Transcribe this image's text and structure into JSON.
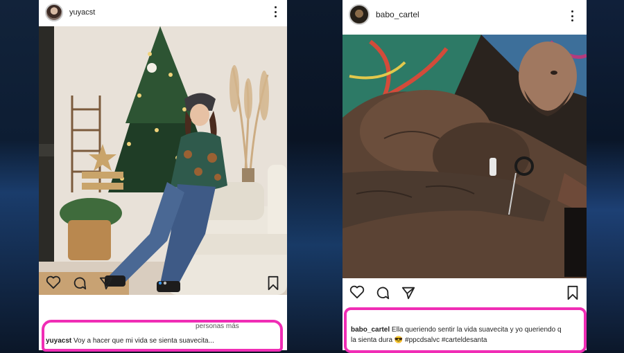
{
  "left_post": {
    "username": "yuyacst",
    "caption_username": "yuyacst",
    "caption_text": "Voy a hacer que mi vida se sienta suavecita...",
    "likes_text_partial": "personas más",
    "icons": [
      "heart-icon",
      "comment-icon",
      "share-icon",
      "bookmark-icon",
      "more-icon"
    ],
    "carousel_dots": 2
  },
  "right_post": {
    "username": "babo_cartel",
    "caption_username": "babo_cartel",
    "caption_line1": "Ella queriendo sentir la vida suavecita y yo queriendo q",
    "caption_line2": "la sienta dura 😎 #ppcdsalvc #carteldesanta",
    "icons": [
      "heart-icon",
      "comment-icon",
      "share-icon",
      "bookmark-icon",
      "more-icon"
    ]
  },
  "colors": {
    "highlight": "#f02db5",
    "background": "#0a1626"
  }
}
